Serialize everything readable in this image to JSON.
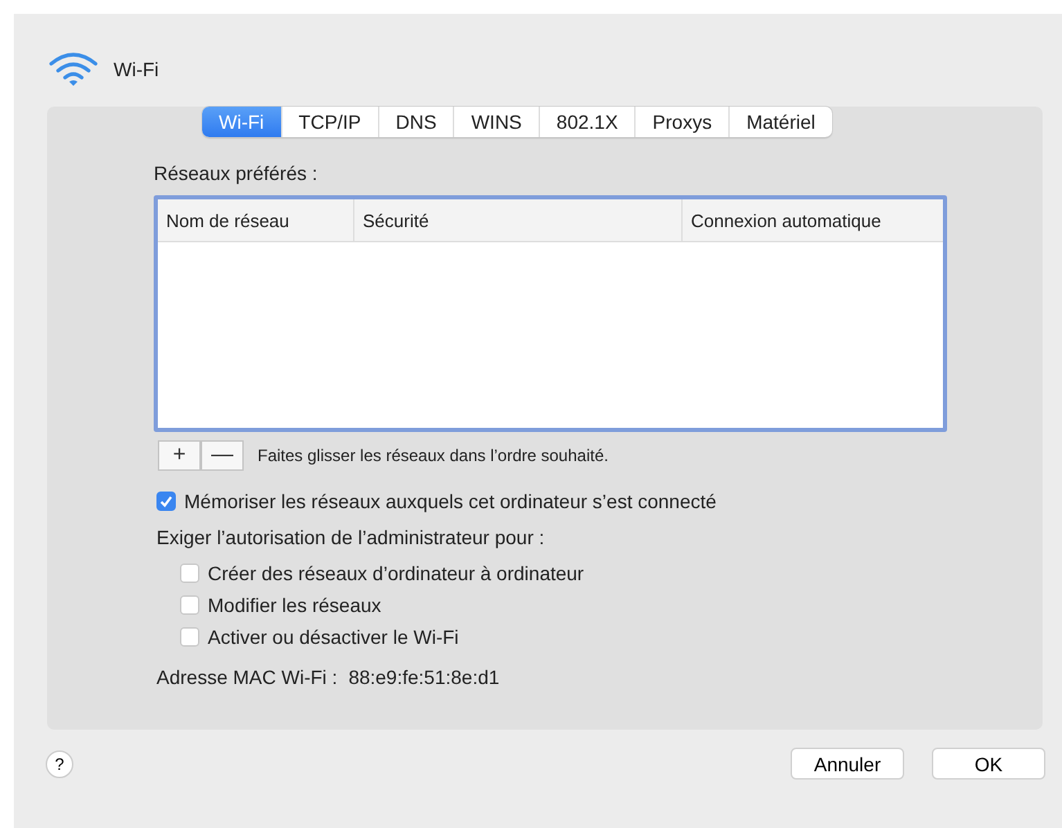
{
  "window": {
    "title": "Wi-Fi"
  },
  "tabs": [
    {
      "label": "Wi-Fi",
      "selected": true
    },
    {
      "label": "TCP/IP",
      "selected": false
    },
    {
      "label": "DNS",
      "selected": false
    },
    {
      "label": "WINS",
      "selected": false
    },
    {
      "label": "802.1X",
      "selected": false
    },
    {
      "label": "Proxys",
      "selected": false
    },
    {
      "label": "Matériel",
      "selected": false
    }
  ],
  "preferred_networks": {
    "label": "Réseaux préférés :",
    "columns": [
      "Nom de réseau",
      "Sécurité",
      "Connexion automatique"
    ]
  },
  "list_buttons": [
    "+",
    "—"
  ],
  "drag_hint": "Faites glisser les réseaux dans l’ordre souhaité.",
  "remember": {
    "label": "Mémoriser les réseaux auxquels cet ordinateur s’est connecté",
    "checked": true
  },
  "admin_label": "Exiger l’autorisation de l’administrateur pour :",
  "admin_options": [
    {
      "label": "Créer des réseaux d’ordinateur à ordinateur",
      "checked": false
    },
    {
      "label": "Modifier les réseaux",
      "checked": false
    },
    {
      "label": "Activer ou désactiver le Wi-Fi",
      "checked": false
    }
  ],
  "mac": {
    "label": "Adresse MAC Wi-Fi :",
    "value": "88:e9:fe:51:8e:d1"
  },
  "help": "?",
  "buttons": [
    "Annuler",
    "OK"
  ]
}
